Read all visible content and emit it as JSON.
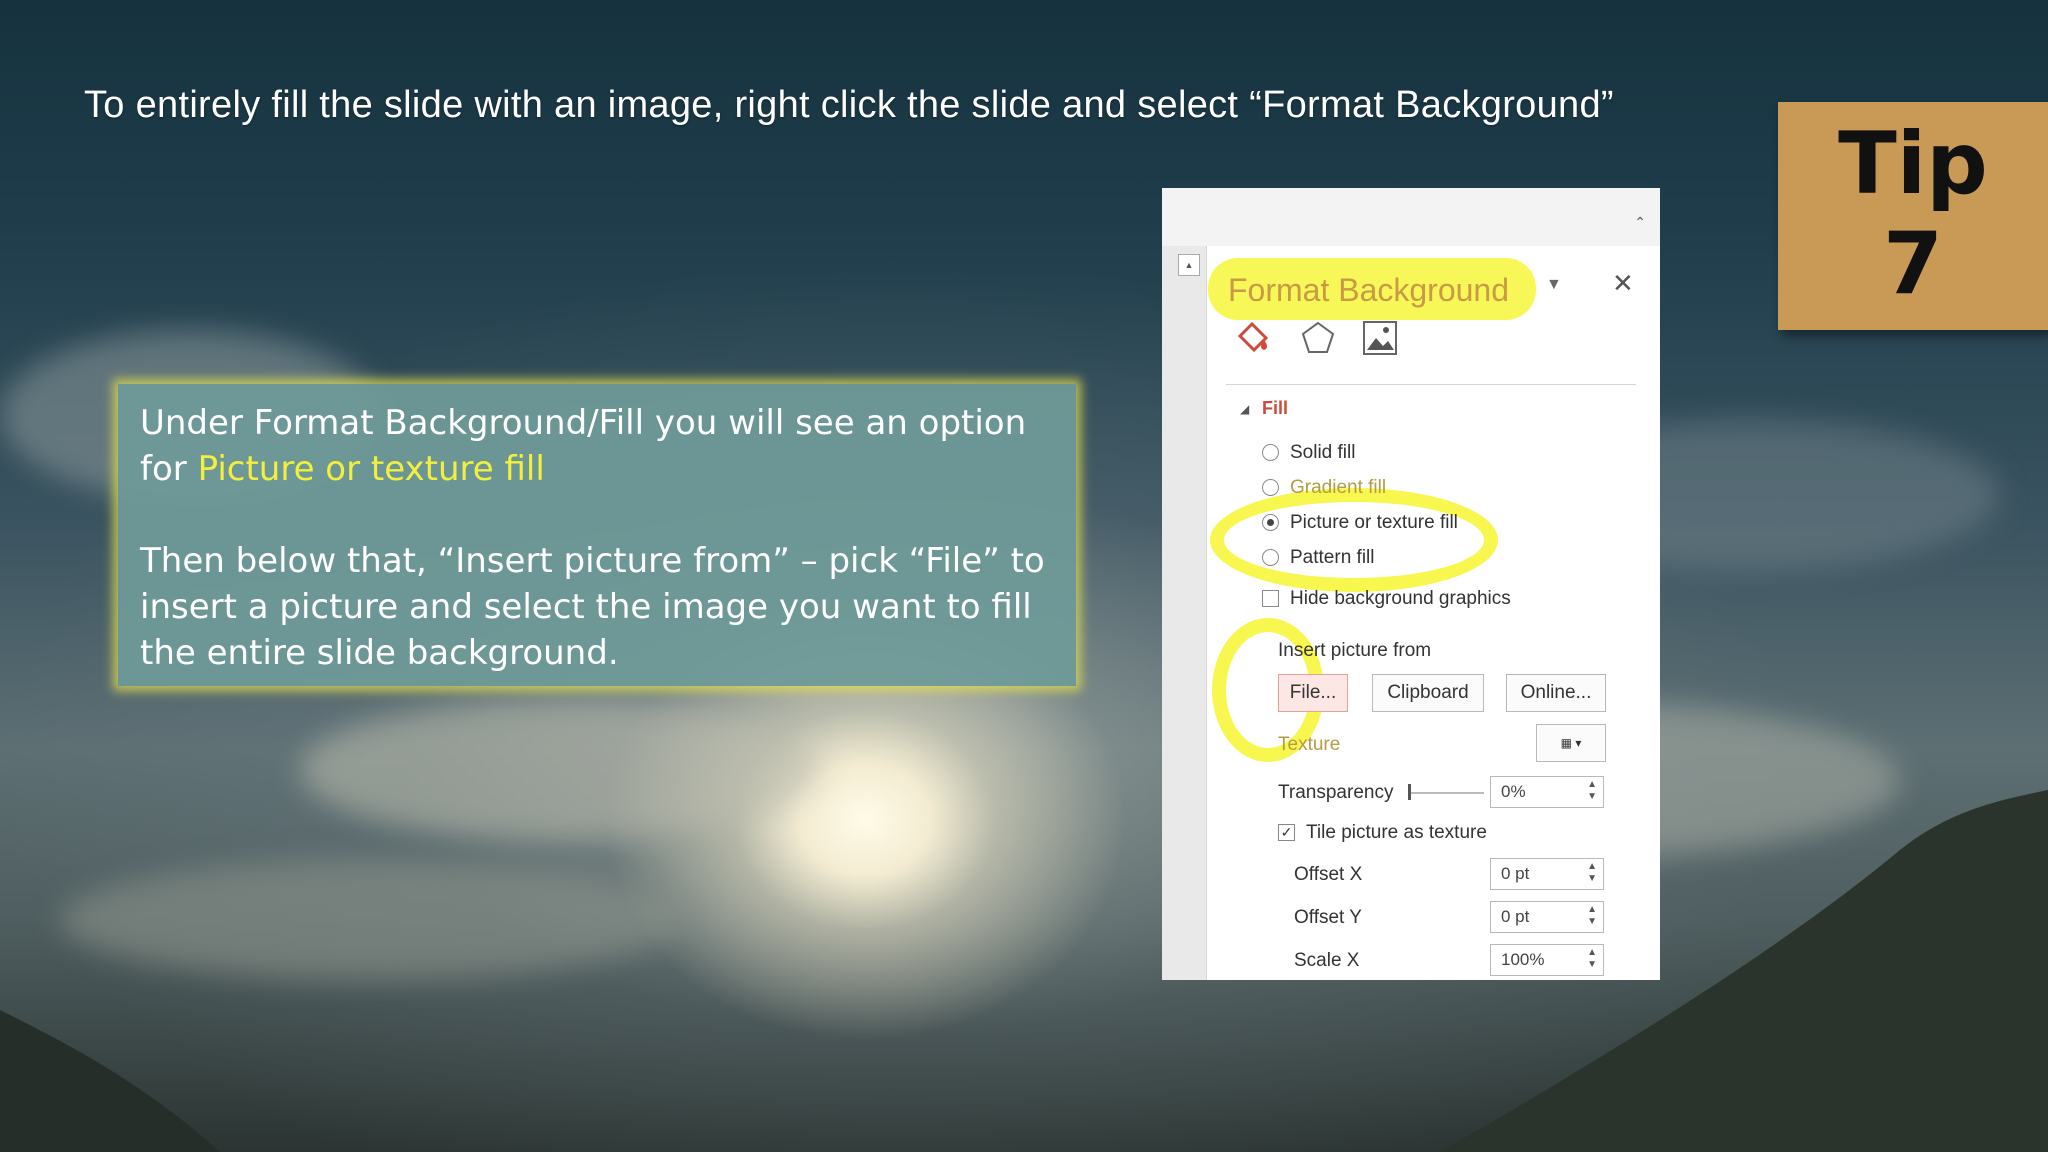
{
  "slide": {
    "instruction": "To entirely fill the slide with an image, right click the slide and select “Format Background”",
    "tip_label": "Tip",
    "tip_number": "7",
    "callout": {
      "line1_prefix": "Under Format Background/Fill you will see an option for ",
      "line1_highlight": "Picture or texture fill",
      "line2": "Then below that, “Insert picture from” – pick “File” to insert a picture and select the image you want to fill the entire slide background."
    }
  },
  "panel": {
    "title": "Format Background",
    "section": "Fill",
    "fill_options": [
      {
        "label": "Solid fill",
        "selected": false
      },
      {
        "label": "Gradient fill",
        "selected": false
      },
      {
        "label": "Picture or texture fill",
        "selected": true
      },
      {
        "label": "Pattern fill",
        "selected": false
      }
    ],
    "hide_background_graphics": "Hide background graphics",
    "insert_picture_from": "Insert picture from",
    "buttons": {
      "file": "File...",
      "clipboard": "Clipboard",
      "online": "Online..."
    },
    "texture_label": "Texture",
    "transparency_label": "Transparency",
    "transparency_value": "0%",
    "tile_label": "Tile picture as texture",
    "tile_checked": true,
    "offset_x_label": "Offset X",
    "offset_x_value": "0 pt",
    "offset_y_label": "Offset Y",
    "offset_y_value": "0 pt",
    "scale_x_label": "Scale X",
    "scale_x_value": "100%"
  },
  "colors": {
    "highlight_yellow": "#f3ef3f",
    "tip_gold": "#c99a55",
    "callout_teal": "#6f9b99",
    "fill_red": "#d04a3a"
  },
  "icons": [
    "fill-bucket-icon",
    "pentagon-effects-icon",
    "picture-icon",
    "close-icon",
    "dropdown-icon",
    "collapse-icon",
    "scroll-up-icon",
    "texture-picker-icon"
  ]
}
